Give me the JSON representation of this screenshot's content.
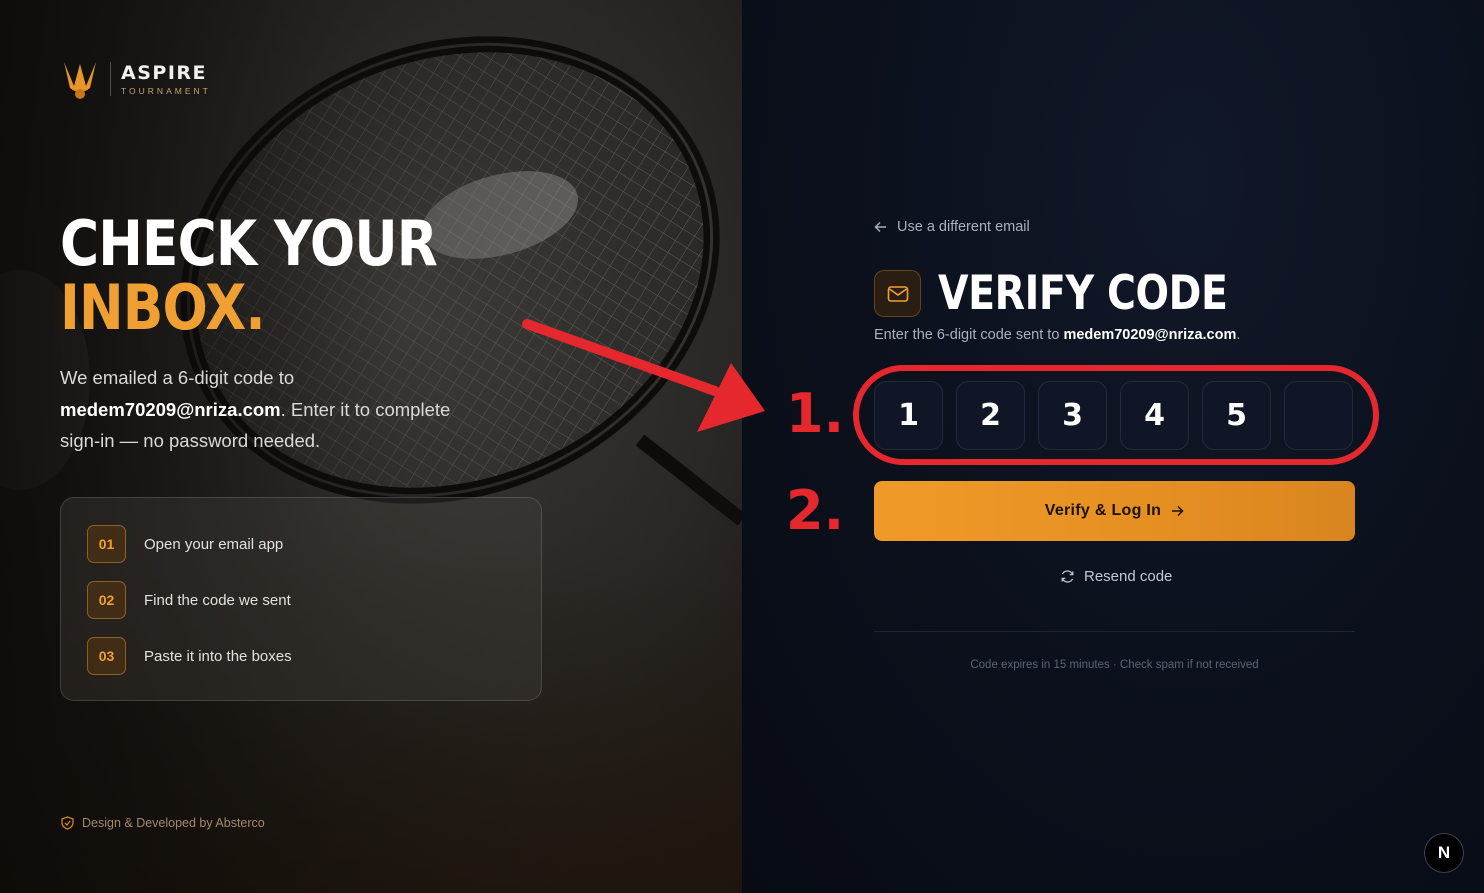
{
  "brand": {
    "name": "ASPIRE",
    "tagline": "TOURNAMENT"
  },
  "hero": {
    "line1": "CHECK YOUR",
    "line2": "INBOX.",
    "lead_prefix": "We emailed a 6-digit code to",
    "email": "medem70209@nriza.com",
    "lead_suffix": ". Enter it to complete sign-in — no password needed."
  },
  "steps": [
    {
      "num": "01",
      "text": "Open your email app"
    },
    {
      "num": "02",
      "text": "Find the code we sent"
    },
    {
      "num": "03",
      "text": "Paste it into the boxes"
    }
  ],
  "credit": "Design & Developed by Absterco",
  "form": {
    "back_label": "Use a different email",
    "title": "VERIFY CODE",
    "sub_prefix": "Enter the 6-digit code sent to",
    "email": "medem70209@nriza.com",
    "sub_suffix": ".",
    "otp_digits": [
      "1",
      "2",
      "3",
      "4",
      "5",
      ""
    ],
    "verify_label": "Verify & Log In",
    "resend_label": "Resend code",
    "footnote": "Code expires in 15 minutes · Check spam if not received"
  },
  "badge": "N",
  "annotations": {
    "step1": "1.",
    "step2": "2."
  },
  "colors": {
    "accent": "#f0a032",
    "annotation_red": "#e5282d",
    "right_bg": "#0b101c"
  },
  "icons": [
    "shuttlecock-logo-icon",
    "arrow-left-icon",
    "mail-icon",
    "arrow-right-icon",
    "refresh-icon",
    "shield-icon"
  ]
}
